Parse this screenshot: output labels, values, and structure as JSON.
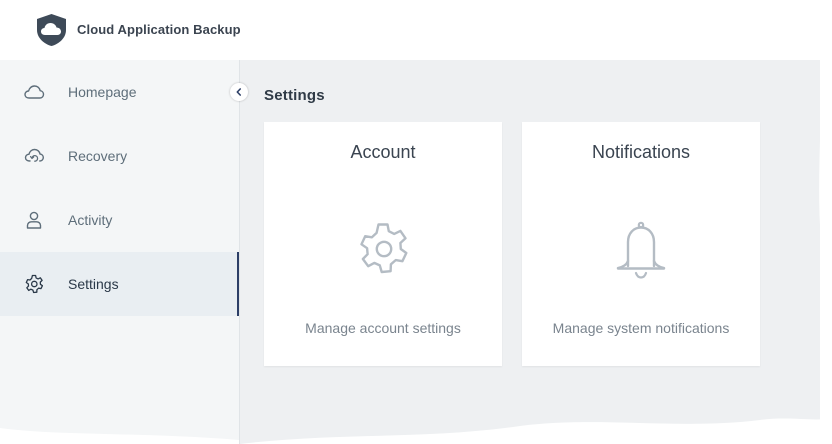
{
  "app": {
    "title": "Cloud Application Backup",
    "logo_icon": "cloud-shield-logo"
  },
  "sidebar": {
    "items": [
      {
        "label": "Homepage",
        "icon": "cloud-icon",
        "active": false
      },
      {
        "label": "Recovery",
        "icon": "cloud-recovery-icon",
        "active": false
      },
      {
        "label": "Activity",
        "icon": "user-icon",
        "active": false
      },
      {
        "label": "Settings",
        "icon": "gear-icon",
        "active": true
      }
    ],
    "collapse_icon": "chevron-left-icon"
  },
  "main": {
    "title": "Settings",
    "cards": [
      {
        "title": "Account",
        "icon": "gear-icon",
        "description": "Manage account settings"
      },
      {
        "title": "Notifications",
        "icon": "bell-icon",
        "description": "Manage system notifications"
      }
    ]
  },
  "colors": {
    "sidebar_bg": "#f4f6f7",
    "main_bg": "#eef0f2",
    "active_border": "#2c3e66",
    "icon_gray": "#b4bcc4"
  }
}
